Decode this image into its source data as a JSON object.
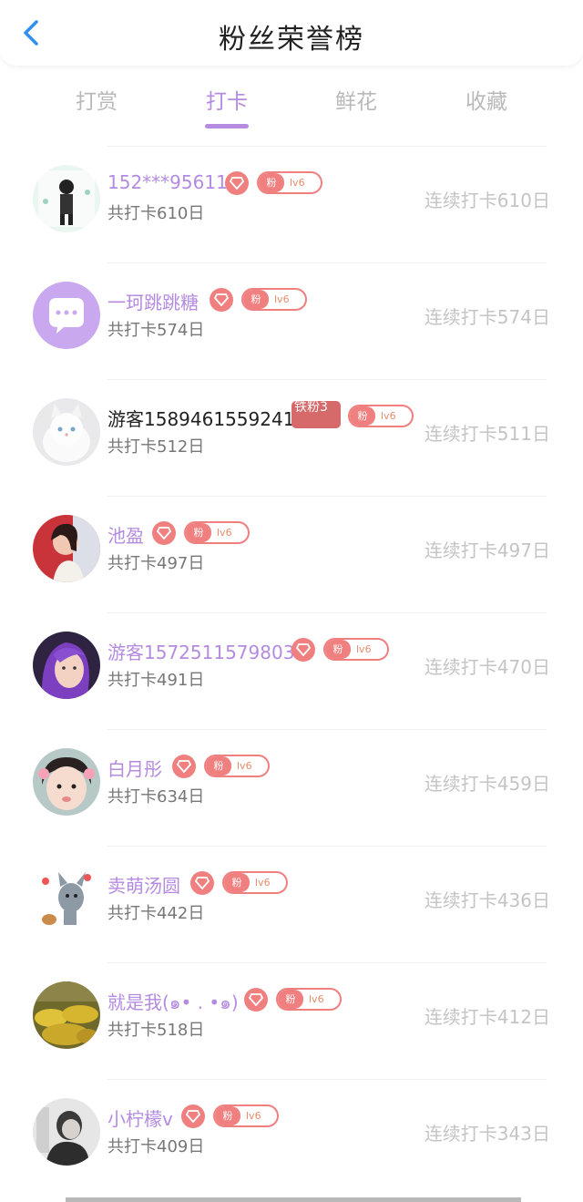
{
  "header": {
    "title": "粉丝荣誉榜",
    "back_icon": "chevron-left-icon"
  },
  "tabs": [
    {
      "label": "打赏",
      "active": false
    },
    {
      "label": "打卡",
      "active": true
    },
    {
      "label": "鲜花",
      "active": false
    },
    {
      "label": "收藏",
      "active": false
    }
  ],
  "colors": {
    "accent": "#b48be0",
    "badge": "#f07f7f",
    "muted": "#c4c4c4"
  },
  "rows": [
    {
      "name": "152***95611",
      "total": "共打卡610日",
      "streak": "连续打卡610日",
      "fan_label": "粉",
      "level": "lv6"
    },
    {
      "name": "一珂跳跳糖",
      "total": "共打卡574日",
      "streak": "连续打卡574日",
      "fan_label": "粉",
      "level": "lv6"
    },
    {
      "name": "游客1589461559241",
      "total": "共打卡512日",
      "streak": "连续打卡511日",
      "iron_badge": "铁粉3",
      "fan_label": "粉",
      "level": "lv6"
    },
    {
      "name": "池盈",
      "total": "共打卡497日",
      "streak": "连续打卡497日",
      "fan_label": "粉",
      "level": "lv6"
    },
    {
      "name": "游客1572511579803",
      "total": "共打卡491日",
      "streak": "连续打卡470日",
      "fan_label": "粉",
      "level": "lv6"
    },
    {
      "name": "白月彤",
      "total": "共打卡634日",
      "streak": "连续打卡459日",
      "fan_label": "粉",
      "level": "lv6"
    },
    {
      "name": "卖萌汤圆",
      "total": "共打卡442日",
      "streak": "连续打卡436日",
      "fan_label": "粉",
      "level": "lv6"
    },
    {
      "name": "就是我(๑• . •๑)",
      "total": "共打卡518日",
      "streak": "连续打卡412日",
      "fan_label": "粉",
      "level": "lv6"
    },
    {
      "name": "小柠檬v",
      "total": "共打卡409日",
      "streak": "连续打卡343日",
      "fan_label": "粉",
      "level": "lv6"
    }
  ]
}
